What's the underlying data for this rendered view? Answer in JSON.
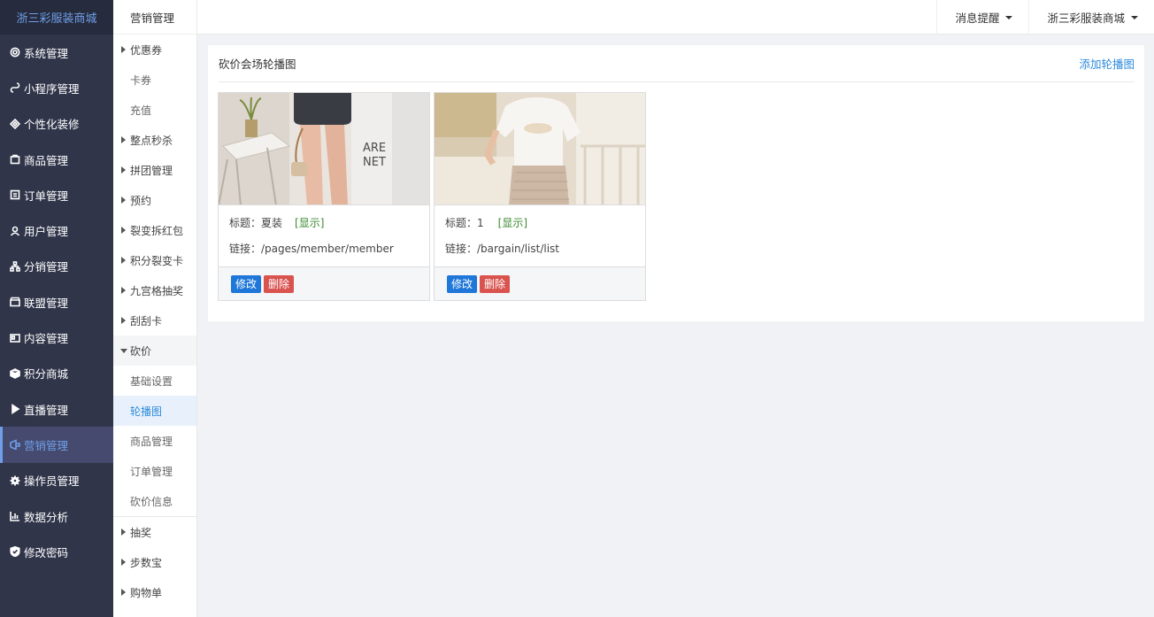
{
  "app": {
    "brand": "浙三彩服装商城"
  },
  "sidebar": {
    "items": [
      {
        "label": "系统管理",
        "icon": "gear-icon"
      },
      {
        "label": "小程序管理",
        "icon": "miniprogram-icon"
      },
      {
        "label": "个性化装修",
        "icon": "decoration-icon"
      },
      {
        "label": "商品管理",
        "icon": "product-icon"
      },
      {
        "label": "订单管理",
        "icon": "order-icon"
      },
      {
        "label": "用户管理",
        "icon": "user-icon"
      },
      {
        "label": "分销管理",
        "icon": "distribution-icon"
      },
      {
        "label": "联盟管理",
        "icon": "alliance-icon"
      },
      {
        "label": "内容管理",
        "icon": "content-icon"
      },
      {
        "label": "积分商城",
        "icon": "points-icon"
      },
      {
        "label": "直播管理",
        "icon": "play-icon"
      },
      {
        "label": "营销管理",
        "icon": "marketing-icon"
      },
      {
        "label": "操作员管理",
        "icon": "cog-icon"
      },
      {
        "label": "数据分析",
        "icon": "chart-icon"
      },
      {
        "label": "修改密码",
        "icon": "shield-icon"
      }
    ],
    "active_index": 11
  },
  "subnav": {
    "title": "营销管理",
    "items": [
      "优惠券",
      "卡券",
      "充值",
      "整点秒杀",
      "拼团管理",
      "预约",
      "裂变拆红包",
      "积分裂变卡",
      "九宫格抽奖",
      "刮刮卡",
      "砍价",
      "基础设置",
      "轮播图",
      "商品管理",
      "订单管理",
      "砍价信息",
      "抽奖",
      "步数宝",
      "购物单"
    ]
  },
  "topbar": {
    "messages_label": "消息提醒",
    "account_label": "浙三彩服装商城"
  },
  "panel": {
    "title": "砍价会场轮播图",
    "add_label": "添加轮播图",
    "cards": [
      {
        "title_label": "标题：",
        "title": "夏装",
        "status": "[显示]",
        "link_label": "链接：",
        "link": "/pages/member/member",
        "edit": "修改",
        "delete": "删除",
        "image_text": [
          "ARE",
          "NET"
        ]
      },
      {
        "title_label": "标题：",
        "title": "1",
        "status": "[显示]",
        "link_label": "链接：",
        "link": "/bargain/list/list",
        "edit": "修改",
        "delete": "删除"
      }
    ]
  },
  "colors": {
    "sidebar_bg": "#30354a",
    "brand_accent": "#6f9fe8",
    "link_blue": "#2e8bdc",
    "edit_blue": "#1e77d9",
    "delete_red": "#d9534f",
    "status_green": "#3a8a2e"
  }
}
